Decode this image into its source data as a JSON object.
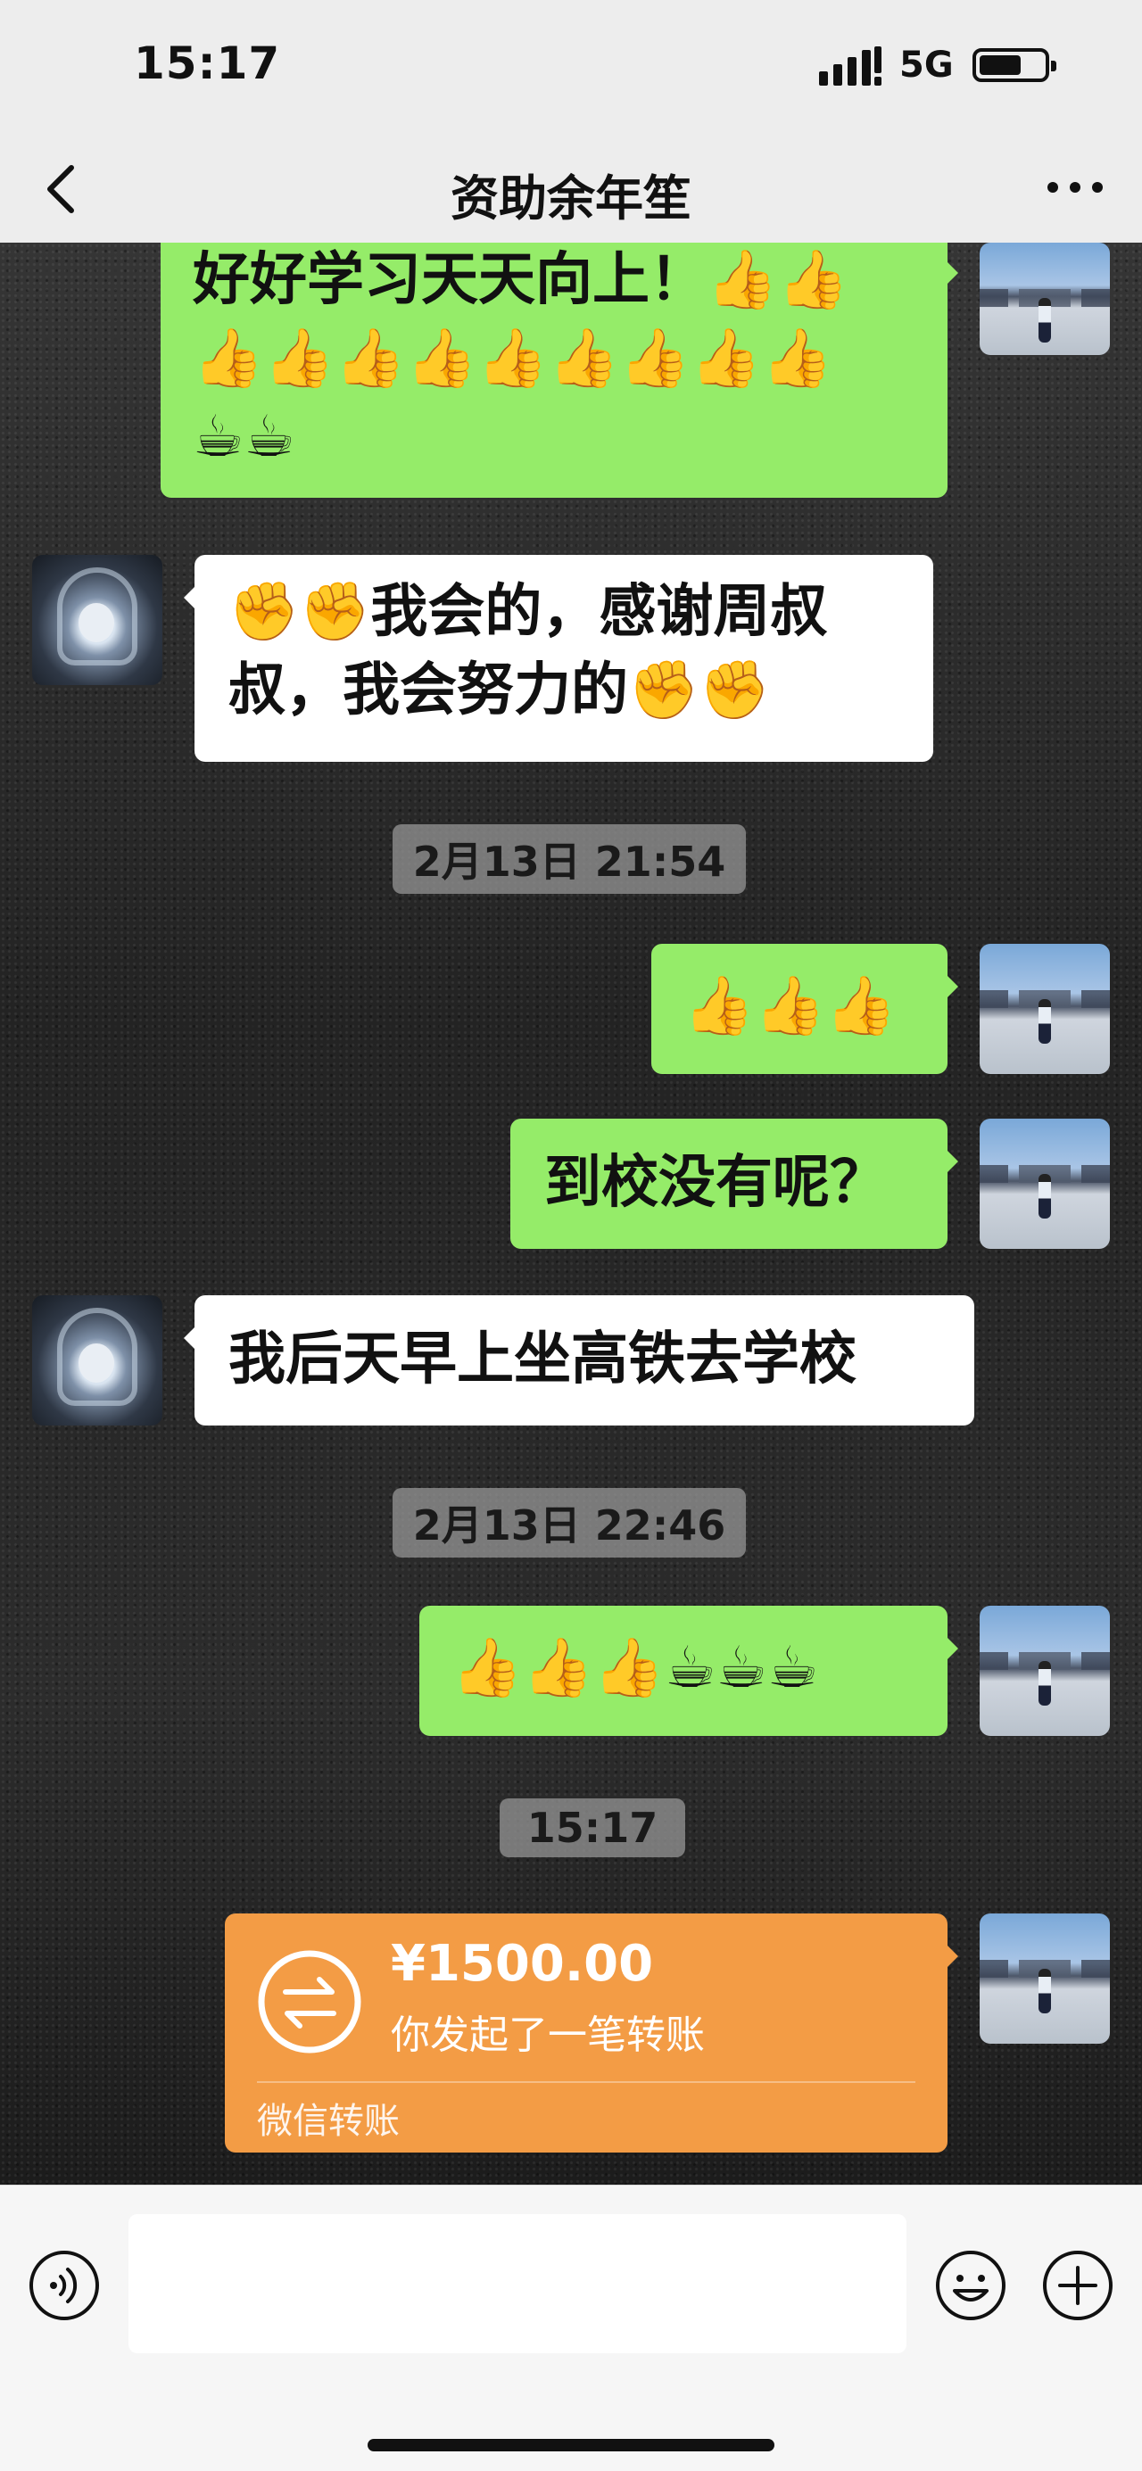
{
  "status_bar": {
    "time": "15:17",
    "network": "5G"
  },
  "nav": {
    "title": "资助余年笙",
    "back_icon": "chevron-left-icon",
    "more_icon": "more-dots-icon"
  },
  "messages": [
    {
      "side": "me",
      "text": "好好学习天天向上！👍👍\n👍👍👍👍👍👍👍👍👍\n☕☕"
    },
    {
      "side": "other",
      "text": "✊✊我会的，感谢周叔\n叔，我会努力的✊✊"
    },
    {
      "side": "time",
      "text": "2月13日 21:54"
    },
    {
      "side": "me",
      "text": "👍👍👍"
    },
    {
      "side": "me",
      "text": "到校没有呢？"
    },
    {
      "side": "other",
      "text": "我后天早上坐高铁去学校"
    },
    {
      "side": "time",
      "text": "2月13日 22:46"
    },
    {
      "side": "me",
      "text": "👍👍👍☕☕☕"
    },
    {
      "side": "time",
      "text": "15:17"
    }
  ],
  "transfer": {
    "amount": "¥1500.00",
    "description": "你发起了一笔转账",
    "footer": "微信转账",
    "icon": "transfer-arrows-icon",
    "color": "#f39c45"
  },
  "input_bar": {
    "voice_icon": "voice-icon",
    "emoji_icon": "emoji-icon",
    "plus_icon": "plus-icon"
  },
  "colors": {
    "my_bubble": "#95ec69",
    "other_bubble": "#ffffff"
  }
}
